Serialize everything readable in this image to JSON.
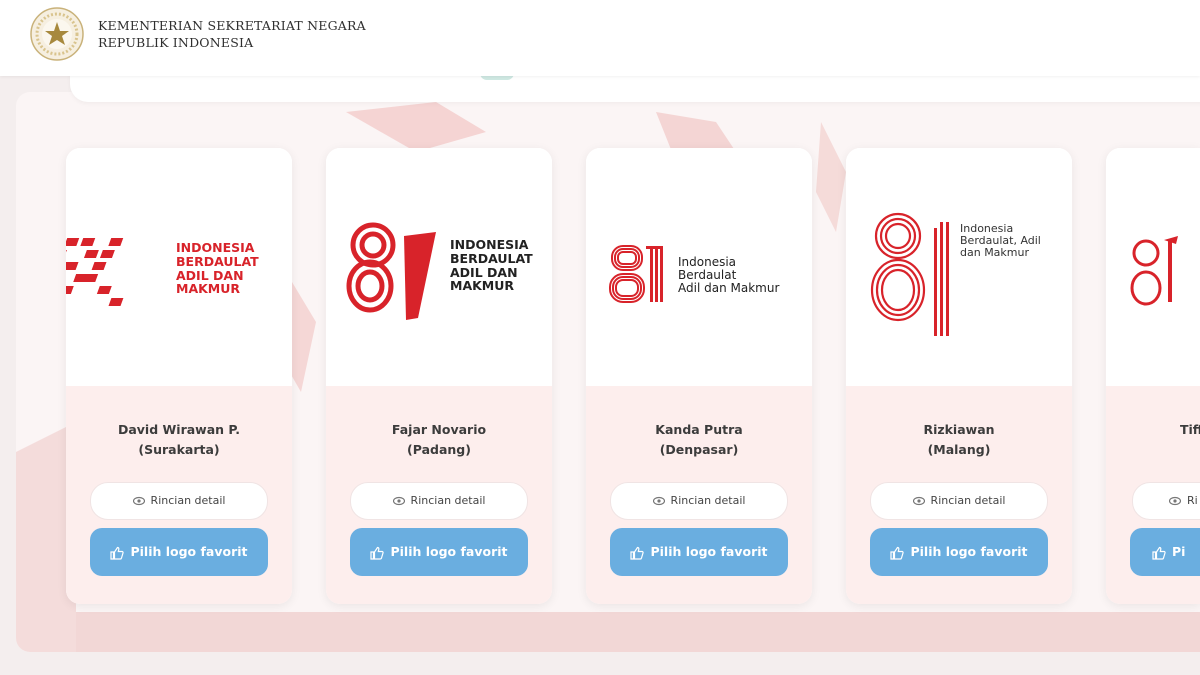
{
  "header": {
    "org_line1": "KEMENTERIAN SEKRETARIAT NEGARA",
    "org_line2": "REPUBLIK INDONESIA"
  },
  "colors": {
    "brand_red": "#d8232a",
    "button_blue": "#6aaee0",
    "card_info_bg": "#fdeeed"
  },
  "cards": [
    {
      "logo_text": [
        "INDONESIA",
        "BERDAULAT",
        "ADIL DAN",
        "MAKMUR"
      ],
      "designer": "David Wirawan P.",
      "city": "(Surakarta)",
      "detail_label": "Rincian detail",
      "fav_label": "Pilih logo favorit"
    },
    {
      "logo_text": [
        "INDONESIA",
        "BERDAULAT",
        "ADIL DAN",
        "MAKMUR"
      ],
      "designer": "Fajar Novario",
      "city": "(Padang)",
      "detail_label": "Rincian detail",
      "fav_label": "Pilih logo favorit"
    },
    {
      "logo_text": [
        "Indonesia",
        "Berdaulat",
        "Adil dan Makmur"
      ],
      "designer": "Kanda Putra",
      "city": "(Denpasar)",
      "detail_label": "Rincian detail",
      "fav_label": "Pilih logo favorit"
    },
    {
      "logo_text": [
        "Indonesia",
        "Berdaulat, Adil",
        "dan Makmur"
      ],
      "designer": "Rizkiawan",
      "city": "(Malang)",
      "detail_label": "Rincian detail",
      "fav_label": "Pilih logo favorit"
    },
    {
      "designer": "Tiffa",
      "city": "(",
      "detail_label": "Ri",
      "fav_label": "Pi"
    }
  ]
}
